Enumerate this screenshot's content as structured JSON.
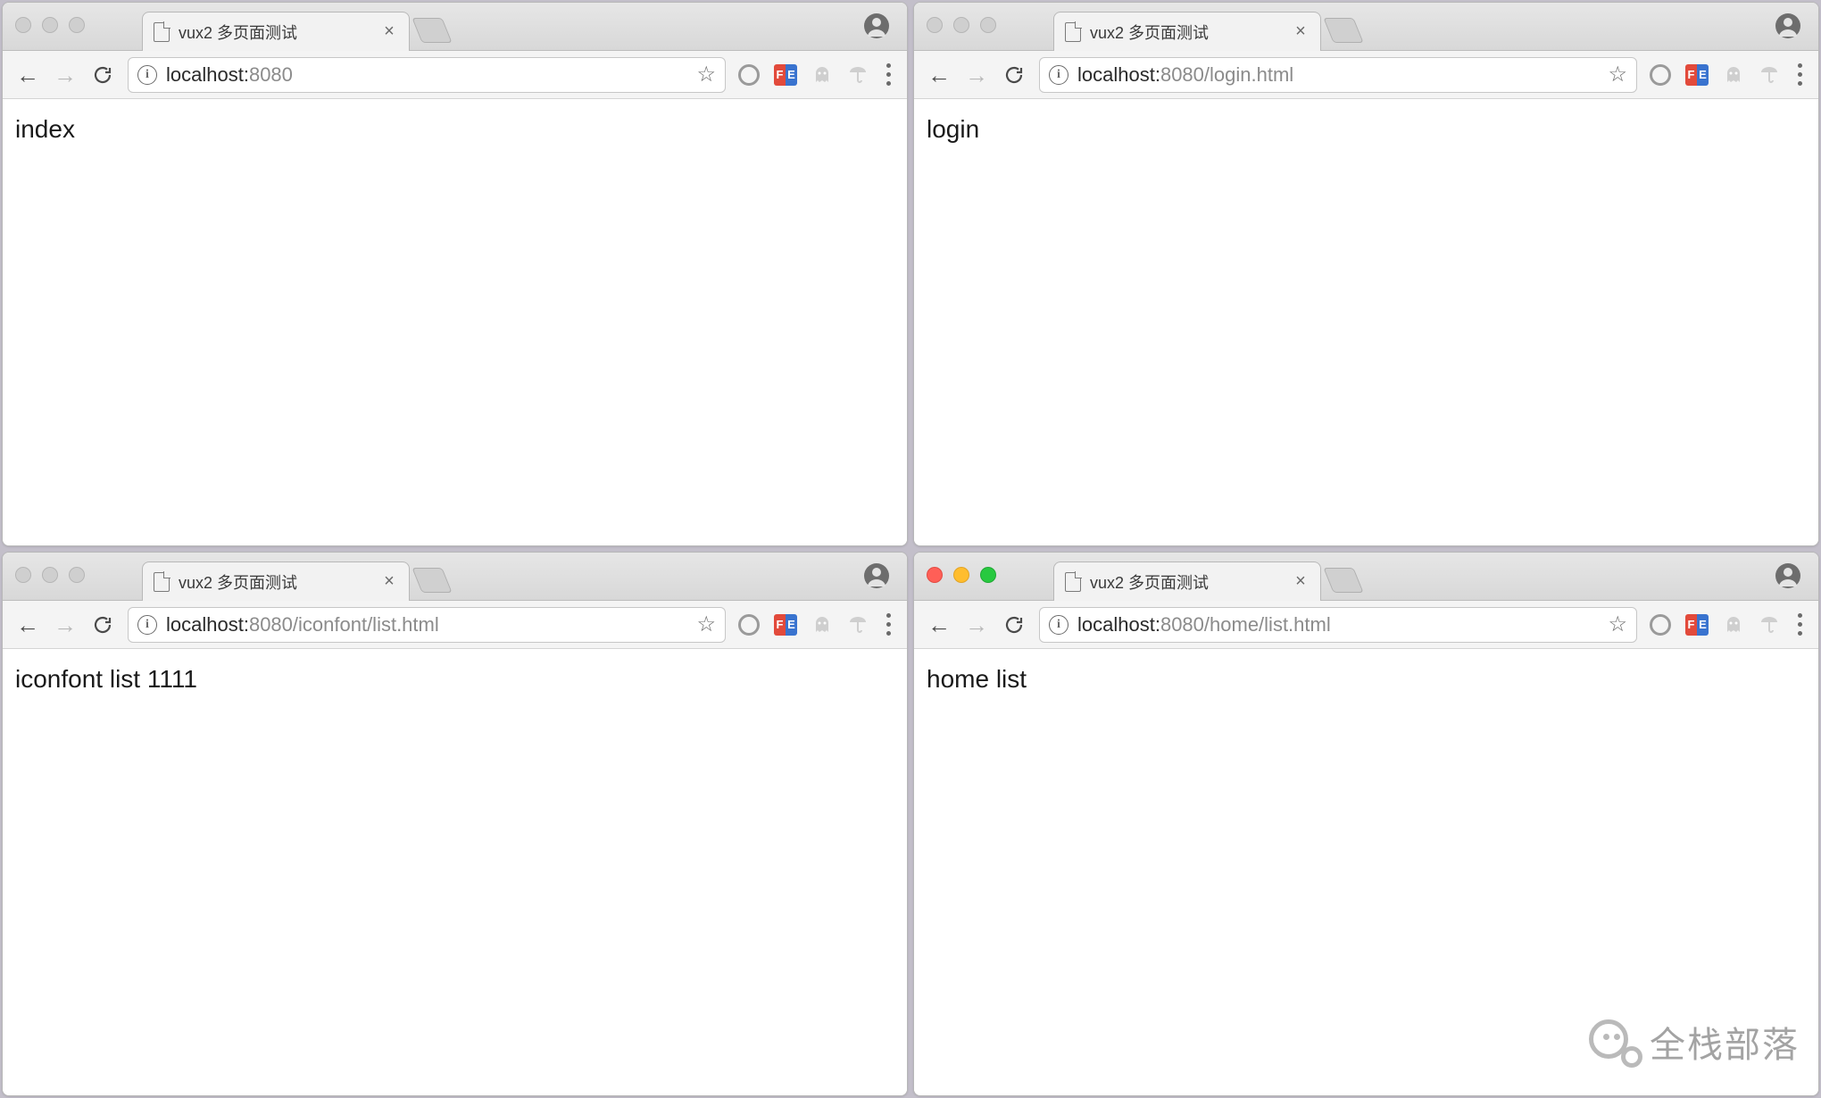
{
  "windows": [
    {
      "id": "w1",
      "active_traffic": false,
      "tab_title": "vux2 多页面测试",
      "url_host": "localhost:",
      "url_port": "8080",
      "url_path": "",
      "page_text": "index",
      "back_enabled": true,
      "forward_enabled": false
    },
    {
      "id": "w2",
      "active_traffic": false,
      "tab_title": "vux2 多页面测试",
      "url_host": "localhost:",
      "url_port": "8080",
      "url_path": "/login.html",
      "page_text": "login",
      "back_enabled": true,
      "forward_enabled": false
    },
    {
      "id": "w3",
      "active_traffic": false,
      "tab_title": "vux2 多页面测试",
      "url_host": "localhost:",
      "url_port": "8080",
      "url_path": "/iconfont/list.html",
      "page_text": "iconfont list 1111",
      "back_enabled": true,
      "forward_enabled": false
    },
    {
      "id": "w4",
      "active_traffic": true,
      "tab_title": "vux2 多页面测试",
      "url_host": "localhost:",
      "url_port": "8080",
      "url_path": "/home/list.html",
      "page_text": "home list",
      "back_enabled": true,
      "forward_enabled": false
    }
  ],
  "icons": {
    "info_char": "i",
    "close_char": "×",
    "star_char": "☆",
    "ext_fe_f": "F",
    "ext_fe_e": "E"
  },
  "watermark_text": "全栈部落"
}
